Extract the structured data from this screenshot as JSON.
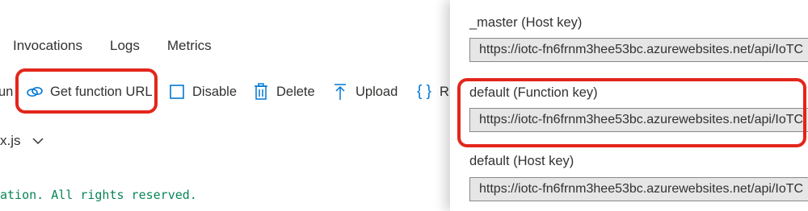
{
  "tabs": [
    "Invocations",
    "Logs",
    "Metrics"
  ],
  "commands": {
    "run_partial": "un",
    "get_function_url": "Get function URL",
    "disable": "Disable",
    "delete": "Delete",
    "upload": "Upload",
    "refresh_partial": "R"
  },
  "file": {
    "name_partial": "x.js"
  },
  "code": {
    "line_partial": "ation. All rights reserved."
  },
  "keys": [
    {
      "label": "_master (Host key)",
      "url": "https://iotc-fn6frnm3hee53bc.azurewebsites.net/api/IoTC"
    },
    {
      "label": "default (Function key)",
      "url": "https://iotc-fn6frnm3hee53bc.azurewebsites.net/api/IoTC"
    },
    {
      "label": "default (Host key)",
      "url": "https://iotc-fn6frnm3hee53bc.azurewebsites.net/api/IoTC"
    }
  ],
  "colors": {
    "accent": "#0078d4",
    "highlight": "#e3261b",
    "code_comment": "#098658"
  }
}
